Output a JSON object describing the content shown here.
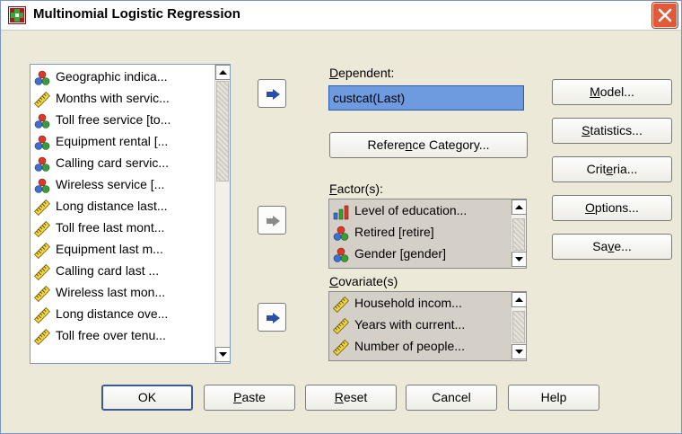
{
  "window": {
    "title": "Multinomial Logistic Regression"
  },
  "source_list": {
    "items": [
      {
        "label": "Geographic indica...",
        "icon": "nominal"
      },
      {
        "label": "Months with servic...",
        "icon": "scale"
      },
      {
        "label": "Toll free service [to...",
        "icon": "nominal"
      },
      {
        "label": "Equipment rental [...",
        "icon": "nominal"
      },
      {
        "label": "Calling card servic...",
        "icon": "nominal"
      },
      {
        "label": "Wireless service [...",
        "icon": "nominal"
      },
      {
        "label": "Long distance last...",
        "icon": "scale"
      },
      {
        "label": "Toll free last mont...",
        "icon": "scale"
      },
      {
        "label": "Equipment last m...",
        "icon": "scale"
      },
      {
        "label": "Calling card last ...",
        "icon": "scale"
      },
      {
        "label": "Wireless last mon...",
        "icon": "scale"
      },
      {
        "label": "Long distance ove...",
        "icon": "scale"
      },
      {
        "label": "Toll free over tenu...",
        "icon": "scale"
      }
    ]
  },
  "dependent": {
    "label_pre": "",
    "label_mnemonic": "D",
    "label_post": "ependent:",
    "value": "custcat(Last)"
  },
  "reference_category_button": {
    "pre": "Refere",
    "mnemonic": "n",
    "post": "ce Category..."
  },
  "factors": {
    "label_pre": "",
    "label_mnemonic": "F",
    "label_post": "actor(s):",
    "items": [
      {
        "label": "Level of education...",
        "icon": "ordinal"
      },
      {
        "label": "Retired [retire]",
        "icon": "nominal"
      },
      {
        "label": "Gender [gender]",
        "icon": "nominal"
      }
    ]
  },
  "covariates": {
    "label_pre": "",
    "label_mnemonic": "C",
    "label_post": "ovariate(s)",
    "items": [
      {
        "label": "Household incom...",
        "icon": "scale"
      },
      {
        "label": "Years with current...",
        "icon": "scale"
      },
      {
        "label": "Number of people...",
        "icon": "scale"
      }
    ]
  },
  "side_buttons": {
    "model": {
      "pre": "",
      "mnemonic": "M",
      "post": "odel..."
    },
    "statistics": {
      "pre": "",
      "mnemonic": "S",
      "post": "tatistics..."
    },
    "criteria": {
      "pre": "Crit",
      "mnemonic": "e",
      "post": "ria..."
    },
    "options": {
      "pre": "",
      "mnemonic": "O",
      "post": "ptions..."
    },
    "save": {
      "pre": "Sa",
      "mnemonic": "v",
      "post": "e..."
    }
  },
  "bottom_buttons": {
    "ok": "OK",
    "paste": {
      "pre": "",
      "mnemonic": "P",
      "post": "aste"
    },
    "reset": {
      "pre": "",
      "mnemonic": "R",
      "post": "eset"
    },
    "cancel": "Cancel",
    "help": "Help"
  },
  "colors": {
    "title_bg": "#ffffff",
    "dialog_bg": "#ece9d8",
    "selection": "#6e9be0",
    "close": "#e05a3a",
    "arrow": "#2a4fa8"
  }
}
